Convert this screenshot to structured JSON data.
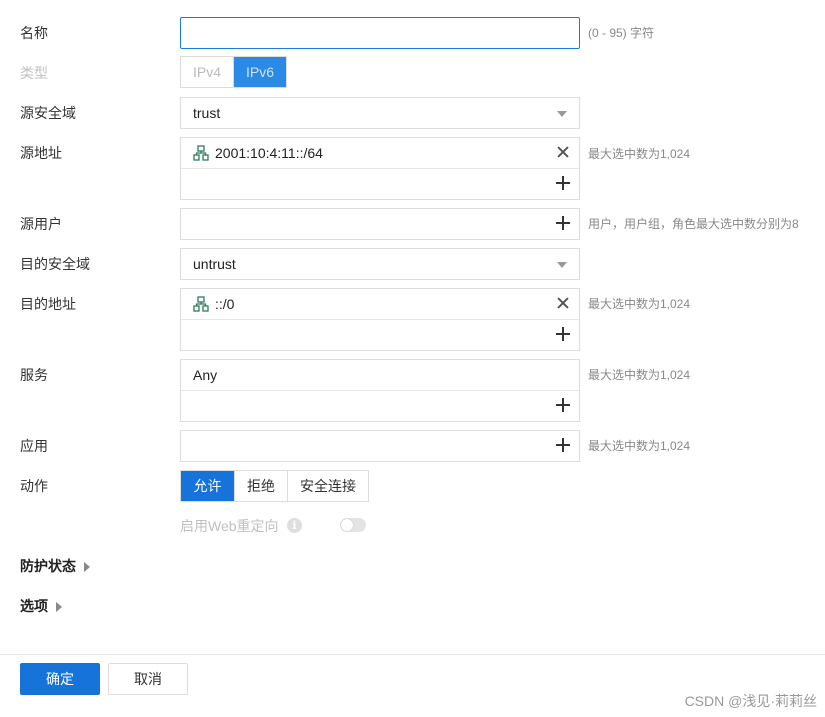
{
  "form": {
    "name": {
      "label": "名称",
      "value": "",
      "hint": "(0 - 95) 字符"
    },
    "type": {
      "label": "类型",
      "options": [
        "IPv4",
        "IPv6"
      ],
      "selected": "IPv6"
    },
    "src_zone": {
      "label": "源安全域",
      "value": "trust"
    },
    "src_addr": {
      "label": "源地址",
      "items": [
        "2001:10:4:11::/64"
      ],
      "hint": "最大选中数为1,024"
    },
    "src_user": {
      "label": "源用户",
      "hint": "用户，用户组，角色最大选中数分别为8"
    },
    "dst_zone": {
      "label": "目的安全域",
      "value": "untrust"
    },
    "dst_addr": {
      "label": "目的地址",
      "items": [
        "::/0"
      ],
      "hint": "最大选中数为1,024"
    },
    "service": {
      "label": "服务",
      "items": [
        "Any"
      ],
      "hint": "最大选中数为1,024"
    },
    "app": {
      "label": "应用",
      "hint": "最大选中数为1,024"
    },
    "action": {
      "label": "动作",
      "options": [
        "允许",
        "拒绝",
        "安全连接"
      ],
      "selected": "允许"
    },
    "web_redirect": {
      "label": "启用Web重定向",
      "info_icon": "i",
      "enabled": false
    }
  },
  "sections": {
    "protection": "防护状态",
    "options": "选项"
  },
  "footer": {
    "ok": "确定",
    "cancel": "取消"
  },
  "watermark": "CSDN @浅见·莉莉丝",
  "colors": {
    "primary": "#1673d9",
    "focus_border": "#1a7ce0",
    "net_icon": "#2e7d5b"
  }
}
